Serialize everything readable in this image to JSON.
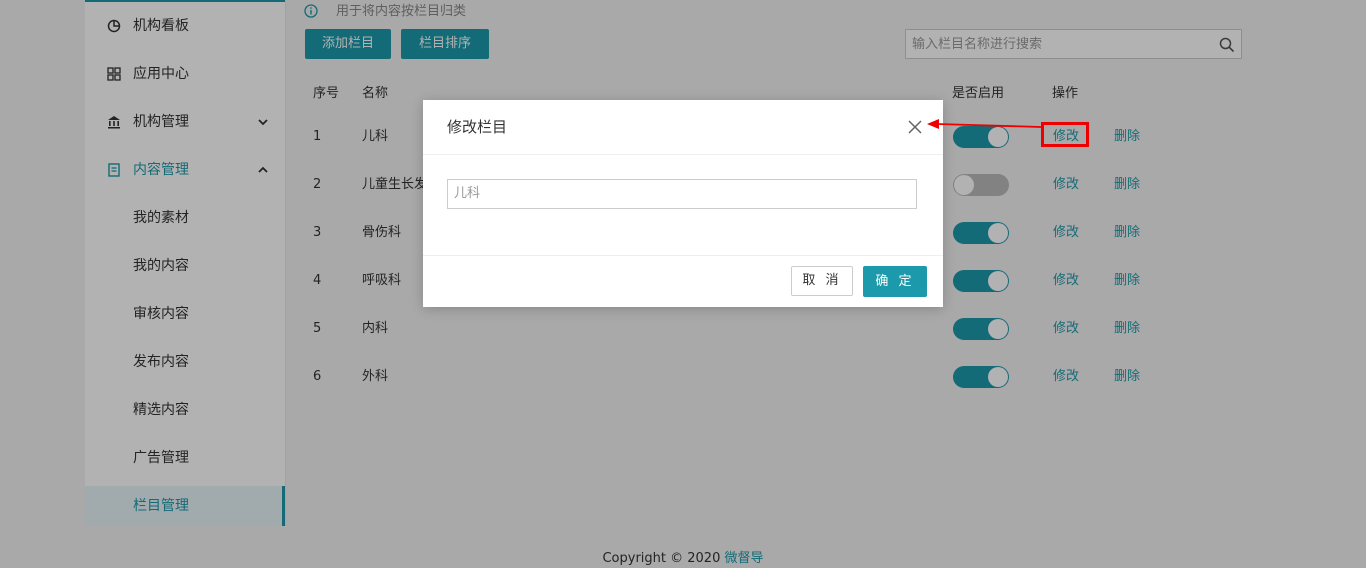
{
  "sidebar": {
    "items": [
      {
        "label": "机构看板",
        "icon": "pie-chart-icon"
      },
      {
        "label": "应用中心",
        "icon": "grid-icon"
      },
      {
        "label": "机构管理",
        "icon": "bank-icon"
      },
      {
        "label": "内容管理",
        "icon": "document-icon"
      }
    ],
    "sub_items": [
      {
        "label": "我的素材"
      },
      {
        "label": "我的内容"
      },
      {
        "label": "审核内容"
      },
      {
        "label": "发布内容"
      },
      {
        "label": "精选内容"
      },
      {
        "label": "广告管理"
      },
      {
        "label": "栏目管理",
        "active": true
      }
    ]
  },
  "page": {
    "info_text": "用于将内容按栏目归类",
    "add_button": "添加栏目",
    "sort_button": "栏目排序",
    "search_placeholder": "输入栏目名称进行搜索"
  },
  "table": {
    "headers": {
      "index": "序号",
      "name": "名称",
      "enabled": "是否启用",
      "actions": "操作"
    },
    "rows": [
      {
        "index": "1",
        "name": "儿科",
        "enabled": true
      },
      {
        "index": "2",
        "name": "儿童生长发育",
        "enabled": false
      },
      {
        "index": "3",
        "name": "骨伤科",
        "enabled": true
      },
      {
        "index": "4",
        "name": "呼吸科",
        "enabled": true
      },
      {
        "index": "5",
        "name": "内科",
        "enabled": true
      },
      {
        "index": "6",
        "name": "外科",
        "enabled": true
      }
    ],
    "edit_label": "修改",
    "delete_label": "删除"
  },
  "footer": {
    "copyright": "Copyright © 2020",
    "brand": "微督导"
  },
  "modal": {
    "title": "修改栏目",
    "input_value": "儿科",
    "cancel_label": "取 消",
    "ok_label": "确 定"
  },
  "colors": {
    "accent": "#1c9aab",
    "annotation": "#ee0000"
  }
}
